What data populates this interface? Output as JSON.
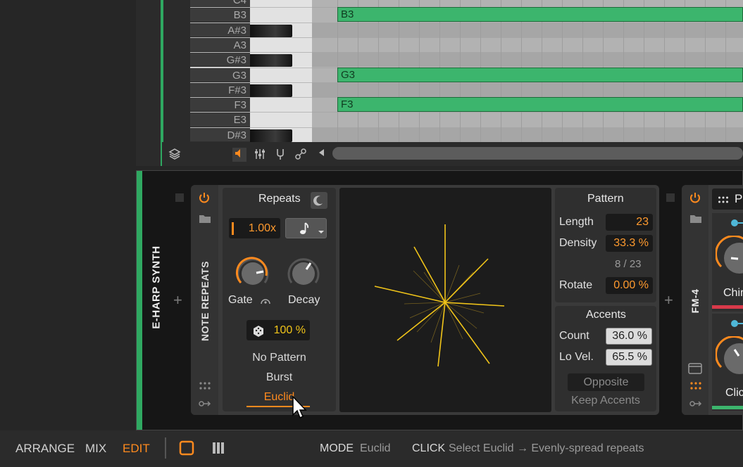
{
  "piano": {
    "keys": [
      {
        "label": "C4",
        "black": false
      },
      {
        "label": "B3",
        "black": false
      },
      {
        "label": "A#3",
        "black": true
      },
      {
        "label": "A3",
        "black": false
      },
      {
        "label": "G#3",
        "black": true
      },
      {
        "label": "G3",
        "black": false
      },
      {
        "label": "F#3",
        "black": true
      },
      {
        "label": "F3",
        "black": false
      },
      {
        "label": "E3",
        "black": false
      },
      {
        "label": "D#3",
        "black": true
      }
    ],
    "notes": [
      {
        "label": "B3",
        "row": 1
      },
      {
        "label": "G3",
        "row": 5
      },
      {
        "label": "F3",
        "row": 7
      }
    ]
  },
  "track": {
    "name": "E-HARP SYNTH"
  },
  "note_repeats": {
    "device_name": "NOTE REPEATS",
    "repeats_title": "Repeats",
    "rate_value": "1.00x",
    "gate_label": "Gate",
    "decay_label": "Decay",
    "probability_value": "100 %",
    "modes": [
      "No Pattern",
      "Burst",
      "Euclid"
    ],
    "selected_mode": "Euclid",
    "pattern": {
      "title": "Pattern",
      "length_label": "Length",
      "length_value": "23",
      "density_label": "Density",
      "density_value": "33.3 %",
      "hits_text": "8 / 23",
      "rotate_label": "Rotate",
      "rotate_value": "0.00 %"
    },
    "accents": {
      "title": "Accents",
      "count_label": "Count",
      "count_value": "36.0 %",
      "lovel_label": "Lo Vel.",
      "lovel_value": "65.5 %",
      "opposite_label": "Opposite",
      "keep_label": "Keep Accents"
    }
  },
  "fm4": {
    "device_name": "FM-4",
    "label_1": "Chir",
    "label_2": "Clic",
    "preset_fragment": "P"
  },
  "status": {
    "nav": [
      "ARRANGE",
      "MIX",
      "EDIT"
    ],
    "active_nav": "EDIT",
    "mode_label": "MODE",
    "mode_value": "Euclid",
    "click_label": "CLICK",
    "click_value": "Select Euclid → Evenly-spread repeats"
  },
  "colors": {
    "accent": "#ff8a1e",
    "green": "#2fa861",
    "note": "#3cb56d",
    "burst_lines": "#f0c419"
  }
}
